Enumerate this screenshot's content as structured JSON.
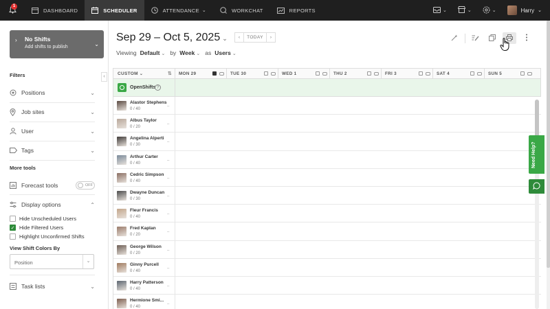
{
  "nav": {
    "notification_count": "1",
    "items": [
      {
        "label": "DASHBOARD",
        "icon": "dashboard-icon"
      },
      {
        "label": "SCHEDULER",
        "icon": "calendar-icon"
      },
      {
        "label": "ATTENDANCE",
        "icon": "clock-icon"
      },
      {
        "label": "WORKCHAT",
        "icon": "chat-icon"
      },
      {
        "label": "REPORTS",
        "icon": "chart-icon"
      }
    ],
    "active_item": "SCHEDULER",
    "user_name": "Harry"
  },
  "publish": {
    "title": "No Shifts",
    "subtitle": "Add shifts to publish"
  },
  "filters": {
    "heading": "Filters",
    "facets": [
      "Positions",
      "Job sites",
      "User",
      "Tags"
    ],
    "more_tools_heading": "More tools",
    "forecast_label": "Forecast tools",
    "forecast_toggle": "OFF",
    "display_options_label": "Display options",
    "options": [
      {
        "label": "Hide Unscheduled Users",
        "checked": false
      },
      {
        "label": "Hide Filtered Users",
        "checked": true
      },
      {
        "label": "Highlight Unconfirmed Shifts",
        "checked": false
      }
    ],
    "colors_heading": "View Shift Colors By",
    "colors_value": "Position",
    "task_lists_label": "Task lists"
  },
  "header": {
    "date_range": "Sep 29 – Oct 5, 2025",
    "today_label": "TODAY",
    "viewing_label": "Viewing",
    "viewing_value": "Default",
    "by_label": "by",
    "by_value": "Week",
    "as_label": "as",
    "as_value": "Users"
  },
  "grid": {
    "first_col_label": "CUSTOM",
    "days": [
      "MON 29",
      "TUE 30",
      "WED 1",
      "THU 2",
      "FRI 3",
      "SAT 4",
      "SUN 5"
    ],
    "open_shifts_label": "OpenShifts",
    "users": [
      {
        "name": "Alastor Stephens",
        "hours": "0 / 40"
      },
      {
        "name": "Albus Taylor",
        "hours": "0 / 20"
      },
      {
        "name": "Angelina Alperti",
        "hours": "0 / 30"
      },
      {
        "name": "Arthur Carter",
        "hours": "0 / 40"
      },
      {
        "name": "Cedric Simpson",
        "hours": "0 / 40"
      },
      {
        "name": "Dwayne Duncan",
        "hours": "0 / 30"
      },
      {
        "name": "Fleur Francis",
        "hours": "0 / 40"
      },
      {
        "name": "Fred Kaplan",
        "hours": "0 / 20"
      },
      {
        "name": "George Wilson",
        "hours": "0 / 20"
      },
      {
        "name": "Ginny Purcell",
        "hours": "0 / 40"
      },
      {
        "name": "Harry Patterson",
        "hours": "0 / 40"
      },
      {
        "name": "Hermione Smi...",
        "hours": "0 / 40"
      }
    ]
  },
  "help_label": "Need Help?",
  "colors": {
    "accent": "#3aa846",
    "nav_bg": "#1f1f1f",
    "open_row_bg": "#e9f6ea"
  }
}
